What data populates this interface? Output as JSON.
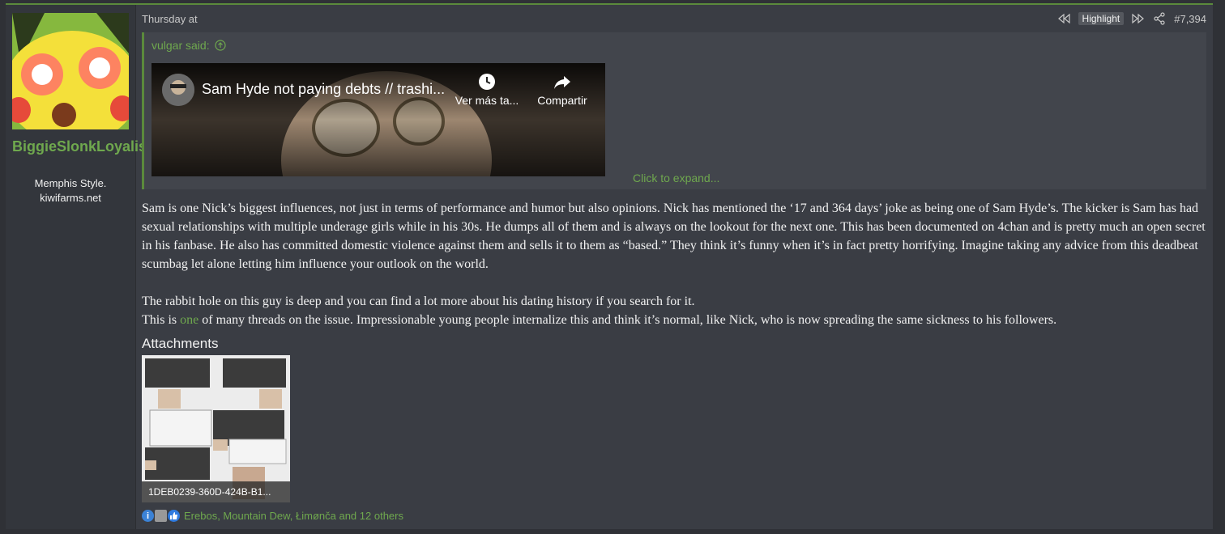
{
  "user": {
    "name": "BiggieSlonkLoyalist",
    "title": "Memphis Style.",
    "site": "kiwifarms.net"
  },
  "post": {
    "date": "Thursday at",
    "highlight_label": "Highlight",
    "number": "#7,394"
  },
  "quote": {
    "author": "vulgar said:",
    "video_title": "Sam Hyde not paying debts // trashi...",
    "watch_later_label": "Ver más ta...",
    "share_label": "Compartir",
    "expand_label": "Click to expand..."
  },
  "body": {
    "paragraph1": "Sam is one Nick’s biggest influences, not just in terms of performance and humor but also opinions. Nick has mentioned the ‘17 and 364 days’ joke as being one of Sam Hyde’s. The kicker is Sam has had sexual relationships with multiple underage girls while in his 30s. He dumps all of them and is always on the lookout for the next one. This has been documented on 4chan and is pretty much an open secret in his fanbase. He also has committed domestic violence against them and sells it to them as “based.” They think it’s funny when it’s in fact pretty horrifying. Imagine taking any advice from this deadbeat scumbag let alone letting him influence your outlook on the world.",
    "paragraph2": "The rabbit hole on this guy is deep and you can find a lot more about his dating history if you search for it.",
    "p3_before": "This is ",
    "p3_link": "one",
    "p3_after": " of many threads on the issue. Impressionable young people internalize this and think it’s normal, like Nick, who is now spreading the same sickness to his followers."
  },
  "attachments": {
    "title": "Attachments",
    "file_name": "1DEB0239-360D-424B-B1..."
  },
  "reactions": {
    "text": "Erebos, Mountain Dew, Łimønča and 12 others"
  },
  "colors": {
    "accent_green": "#6fa84e",
    "post_bg": "#3a3d44",
    "user_bg": "#33363c"
  }
}
